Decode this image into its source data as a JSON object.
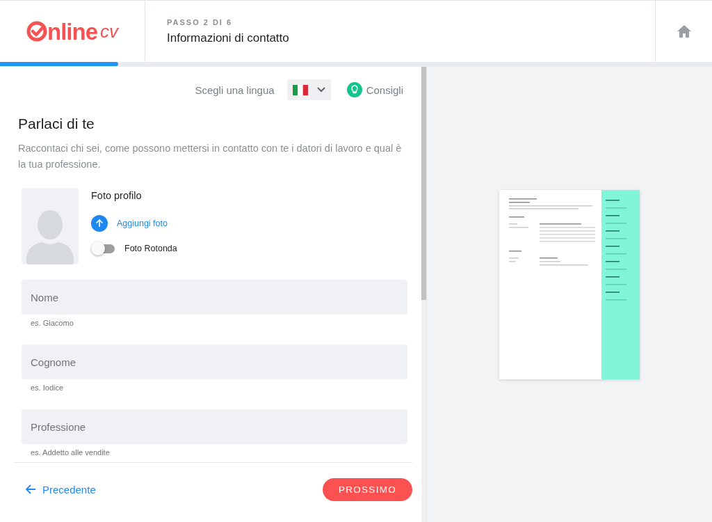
{
  "header": {
    "logo": {
      "text": "nline",
      "suffix": "cv"
    },
    "step": "PASSO 2 DI 6",
    "title": "Informazioni di contatto"
  },
  "progress": {
    "level": 0.166
  },
  "toolbar": {
    "language_label": "Scegli una lingua",
    "tips": "Consigli"
  },
  "intro": {
    "heading": "Parlaci di te",
    "description": "Raccontaci chi sei, come possono mettersi in contatto con te i datori di lavoro e qual è la tua professione."
  },
  "photo": {
    "title": "Foto profilo",
    "upload": "Aggiungi foto",
    "round_photo": {
      "label": "Foto Rotonda",
      "on": false
    }
  },
  "fields": [
    {
      "placeholder": "Nome",
      "hint": "es. Giacomo"
    },
    {
      "placeholder": "Cognome",
      "hint": "es. Iodice"
    },
    {
      "placeholder": "Professione",
      "hint": "es. Addetto alle vendite"
    }
  ],
  "footer": {
    "back": "Precedente",
    "next": "PROSSIMO"
  }
}
